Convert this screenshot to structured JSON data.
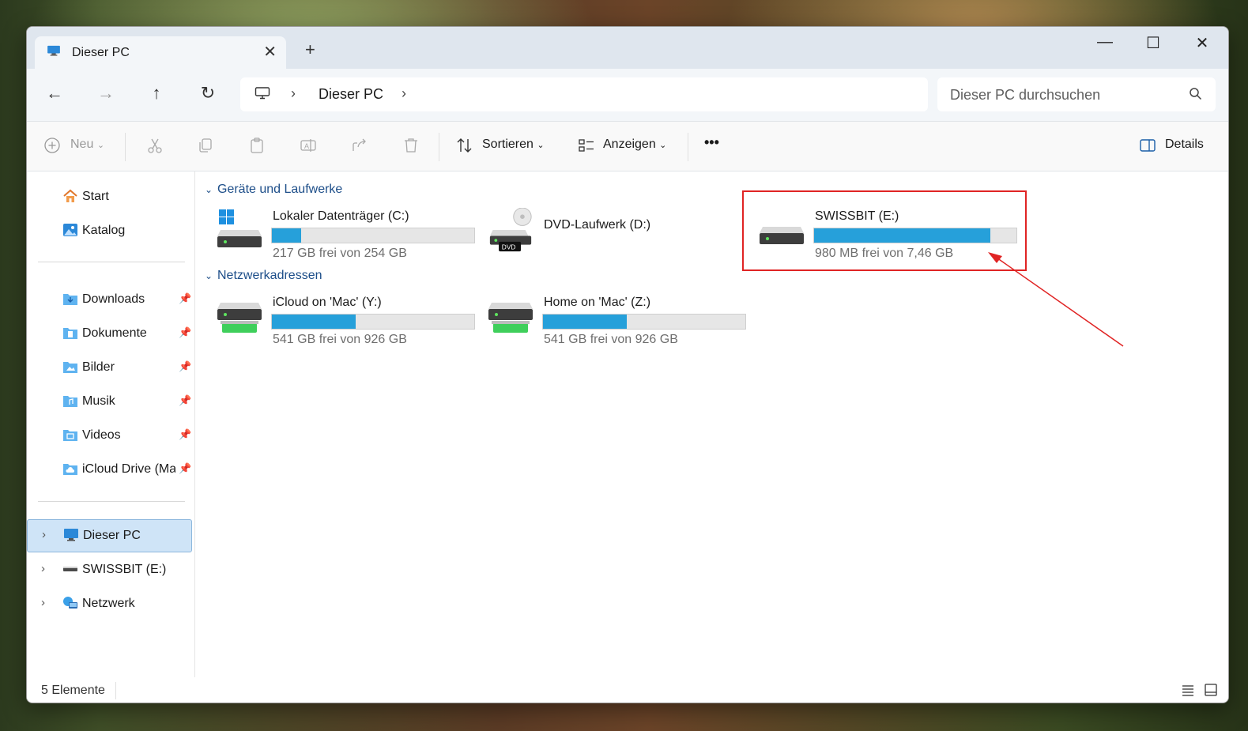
{
  "tab": {
    "title": "Dieser PC"
  },
  "address": {
    "location": "Dieser PC"
  },
  "search": {
    "placeholder": "Dieser PC durchsuchen"
  },
  "toolbar": {
    "new_label": "Neu",
    "sort_label": "Sortieren",
    "view_label": "Anzeigen",
    "more_label": "•••",
    "details_label": "Details"
  },
  "sidebar": {
    "quick": [
      {
        "label": "Start",
        "icon": "home-icon"
      },
      {
        "label": "Katalog",
        "icon": "gallery-icon"
      }
    ],
    "pinned": [
      {
        "label": "Downloads",
        "icon": "downloads-folder-icon"
      },
      {
        "label": "Dokumente",
        "icon": "documents-folder-icon"
      },
      {
        "label": "Bilder",
        "icon": "pictures-folder-icon"
      },
      {
        "label": "Musik",
        "icon": "music-folder-icon"
      },
      {
        "label": "Videos",
        "icon": "videos-folder-icon"
      },
      {
        "label": "iCloud Drive (Mac)",
        "icon": "icloud-folder-icon"
      }
    ],
    "tree": [
      {
        "label": "Dieser PC",
        "icon": "pc-icon",
        "selected": true
      },
      {
        "label": "SWISSBIT (E:)",
        "icon": "usb-drive-icon"
      },
      {
        "label": "Netzwerk",
        "icon": "network-icon"
      }
    ]
  },
  "groups": {
    "devices": {
      "title": "Geräte und Laufwerke",
      "drives": [
        {
          "name": "Lokaler Datenträger (C:)",
          "free": "217 GB frei von 254 GB",
          "used_fraction": 0.146,
          "icon": "system-drive-icon"
        },
        {
          "name": "DVD-Laufwerk (D:)",
          "free": "",
          "icon": "dvd-drive-icon"
        },
        {
          "name": "SWISSBIT (E:)",
          "free": "980 MB frei von 7,46 GB",
          "used_fraction": 0.87,
          "icon": "usb-drive-icon"
        }
      ]
    },
    "network": {
      "title": "Netzwerkadressen",
      "drives": [
        {
          "name": "iCloud on 'Mac' (Y:)",
          "free": "541 GB frei von 926 GB",
          "used_fraction": 0.416,
          "icon": "network-drive-icon"
        },
        {
          "name": "Home on 'Mac' (Z:)",
          "free": "541 GB frei von 926 GB",
          "used_fraction": 0.416,
          "icon": "network-drive-icon"
        }
      ]
    }
  },
  "status": {
    "count": "5 Elemente"
  },
  "colors": {
    "accent": "#26a0da",
    "highlight": "#e02424",
    "group_heading": "#1d4e89"
  }
}
